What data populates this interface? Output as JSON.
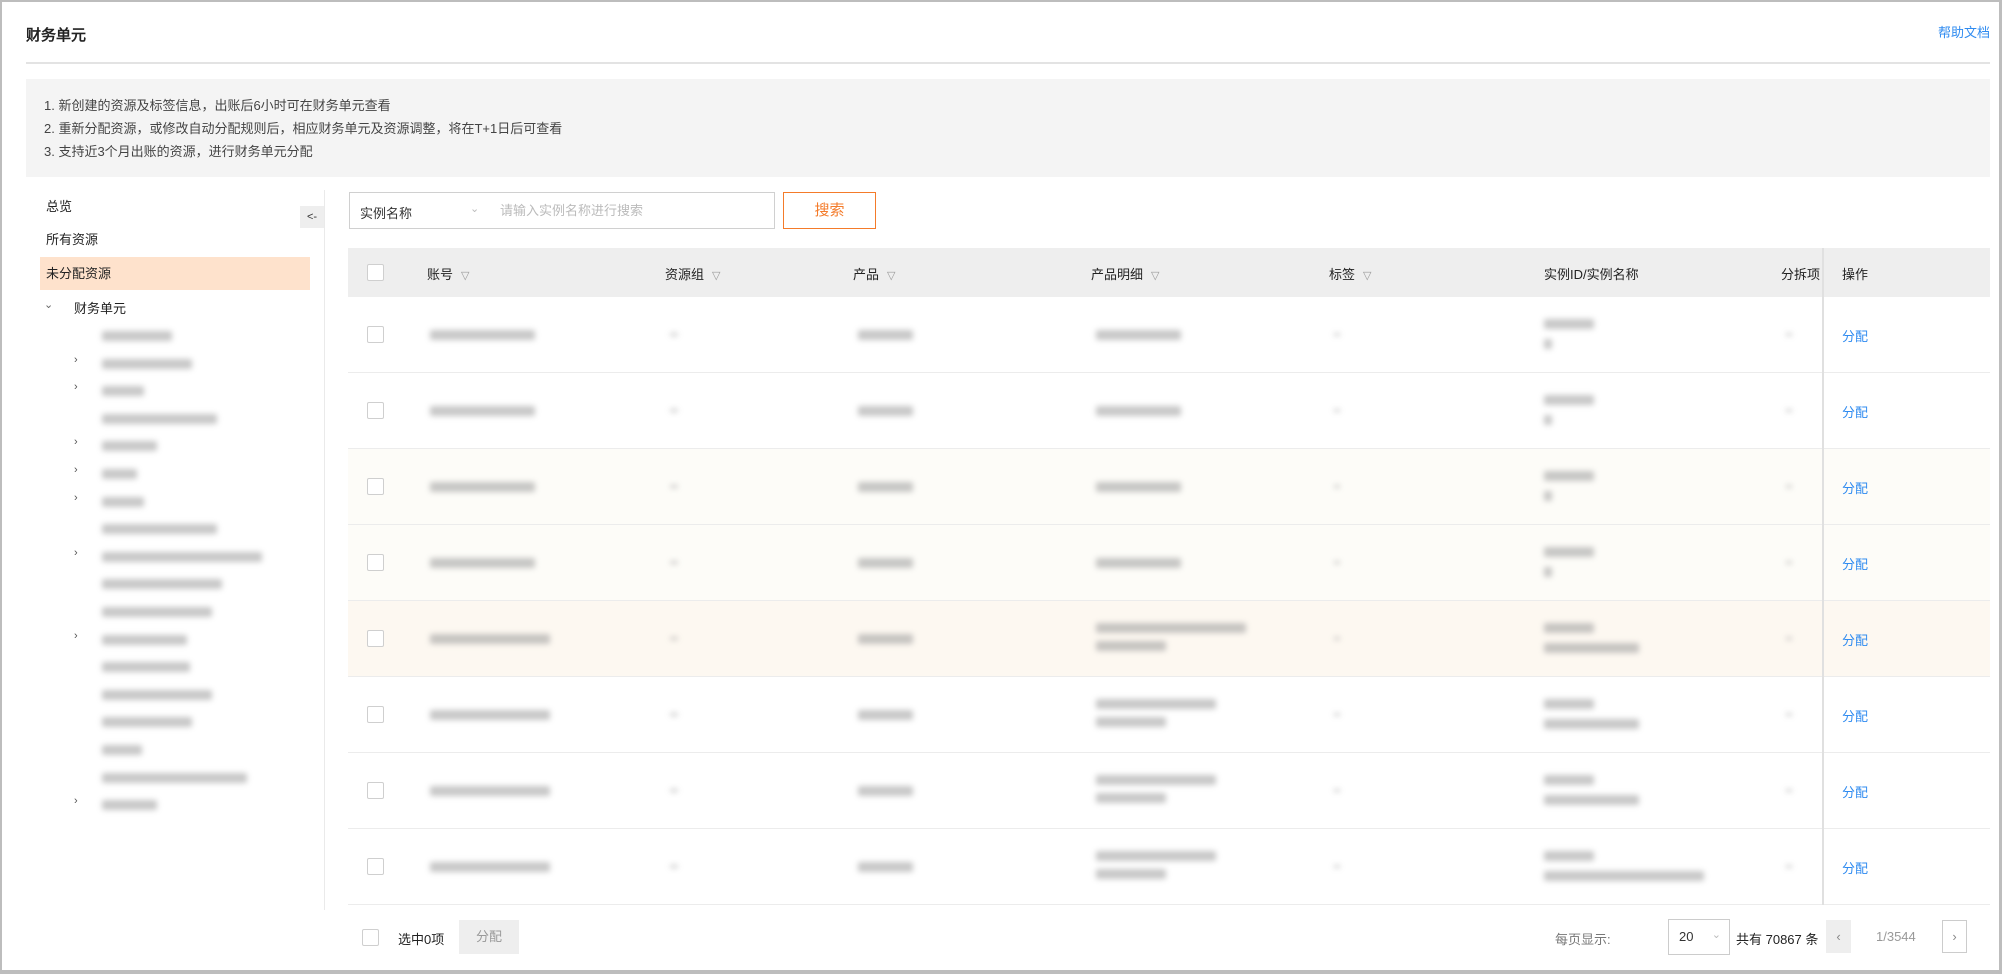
{
  "header": {
    "title": "财务单元",
    "help_link": "帮助文档"
  },
  "notice": [
    "1. 新创建的资源及标签信息，出账后6小时可在财务单元查看",
    "2. 重新分配资源，或修改自动分配规则后，相应财务单元及资源调整，将在T+1日后可查看",
    "3. 支持近3个月出账的资源，进行财务单元分配"
  ],
  "sidebar": {
    "items": [
      {
        "label": "总览"
      },
      {
        "label": "所有资源"
      },
      {
        "label": "未分配资源"
      }
    ],
    "tree_root": "财务单元",
    "collapse_label": "<-"
  },
  "search": {
    "field": "实例名称",
    "placeholder": "请输入实例名称进行搜索",
    "button": "搜索"
  },
  "table": {
    "columns": [
      "账号",
      "资源组",
      "产品",
      "产品明细",
      "标签",
      "实例ID/实例名称",
      "分拆项",
      "操作"
    ],
    "row_action": "分配"
  },
  "footer": {
    "selected": "选中0项",
    "assign": "分配",
    "page_size_label": "每页显示:",
    "page_size": "20",
    "total": "共有 70867 条",
    "page": "1/3544",
    "prev": "‹",
    "next": "›"
  }
}
